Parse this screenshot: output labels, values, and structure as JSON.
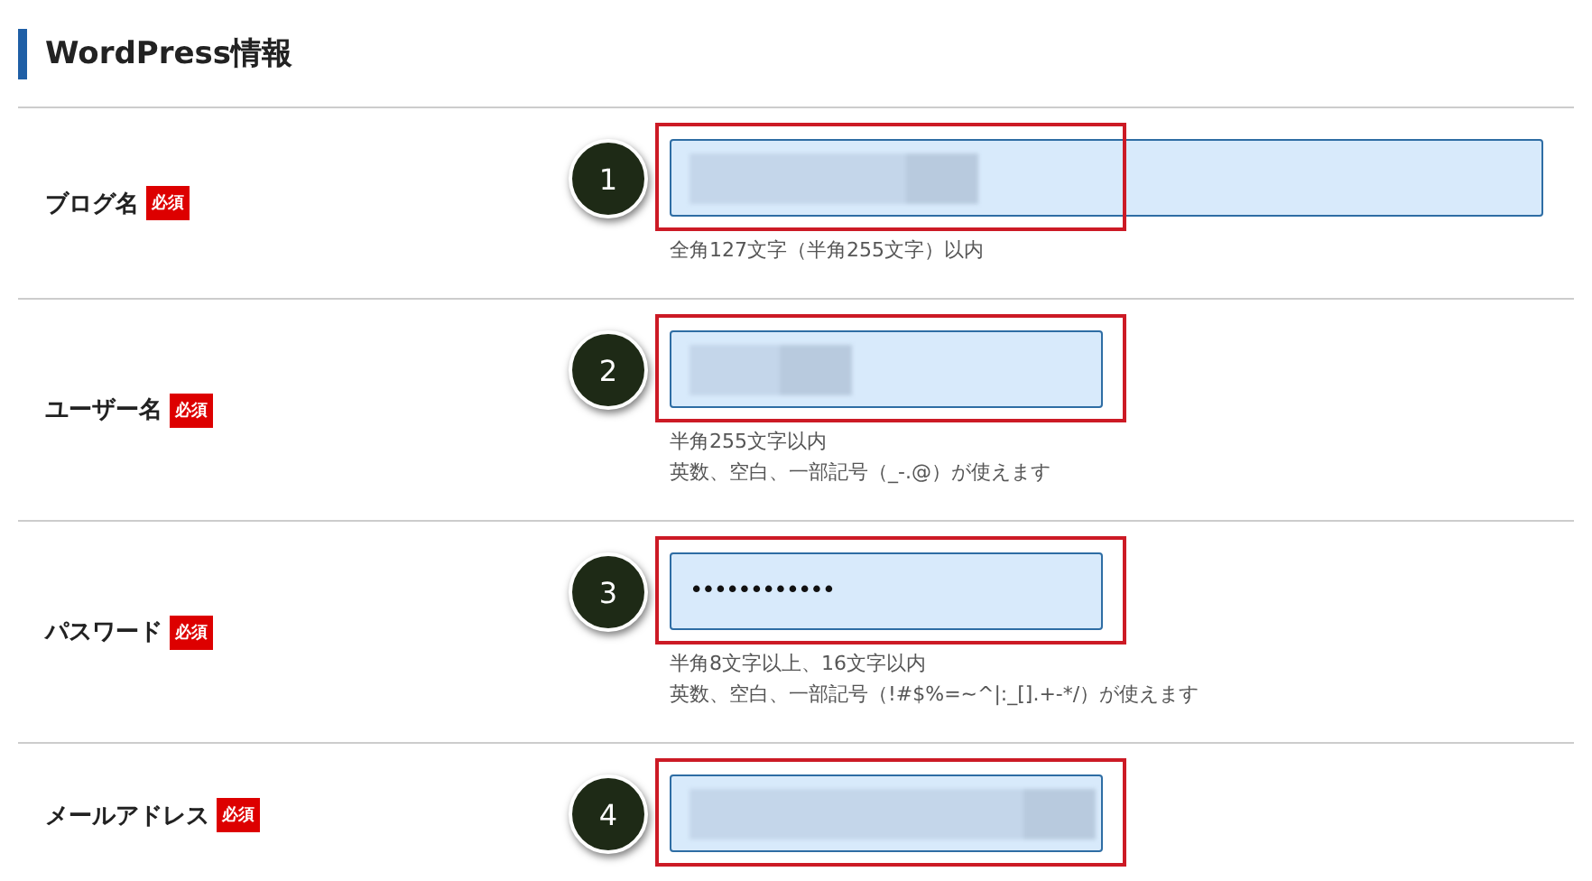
{
  "heading": "WordPress情報",
  "rows": [
    {
      "label": "ブログ名",
      "badge": "必須",
      "step": "1",
      "field": {
        "kind": "redacted",
        "wide": true
      },
      "hints": [
        "全角127文字（半角255文字）以内"
      ]
    },
    {
      "label": "ユーザー名",
      "badge": "必須",
      "step": "2",
      "field": {
        "kind": "redacted",
        "wide": false
      },
      "hints": [
        "半角255文字以内",
        "英数、空白、一部記号（_-.@）が使えます"
      ]
    },
    {
      "label": "パスワード",
      "badge": "必須",
      "step": "3",
      "field": {
        "kind": "password",
        "wide": false,
        "value": "••••••••••••"
      },
      "hints": [
        "半角8文字以上、16文字以内",
        "英数、空白、一部記号（!#$%=~^|:_[].+-*/）が使えます"
      ]
    },
    {
      "label": "メールアドレス",
      "badge": "必須",
      "step": "4",
      "field": {
        "kind": "redacted",
        "wide": false
      },
      "hints": []
    }
  ]
}
